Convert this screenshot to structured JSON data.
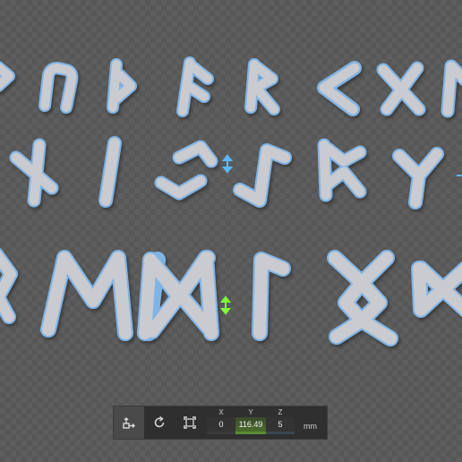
{
  "toolbar": {
    "tools": [
      {
        "icon": "move-tool-icon"
      },
      {
        "icon": "rotate-icon"
      },
      {
        "icon": "scale-icon"
      }
    ],
    "x_label": "X",
    "x_value": "0",
    "y_label": "Y",
    "y_value": "116.49",
    "z_label": "Z",
    "z_value": "5",
    "unit": "mm"
  },
  "colors": {
    "rune_fill": "#c9cbd0",
    "rune_outline": "#7fb4e6",
    "y_axis_gizmo": "#7dff3a",
    "z_axis_gizmo": "#5ab8ff"
  }
}
